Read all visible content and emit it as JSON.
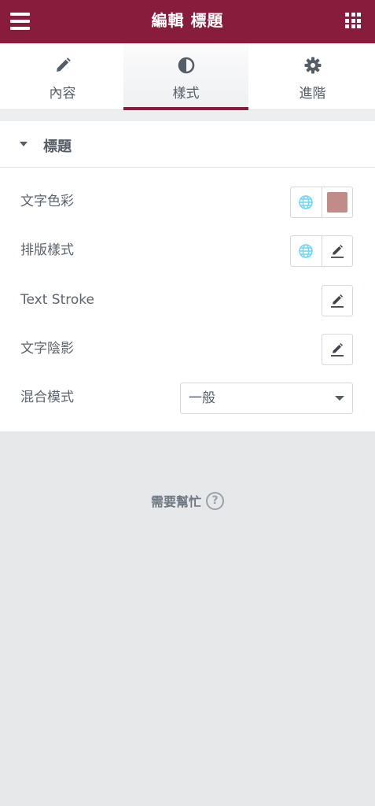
{
  "header": {
    "title": "編輯 標題",
    "menu_icon": "hamburger-icon",
    "apps_icon": "grid-icon",
    "background_color": "#871c3c"
  },
  "tabs": [
    {
      "label": "內容",
      "icon": "pencil-icon",
      "active": false
    },
    {
      "label": "樣式",
      "icon": "half-circle-icon",
      "active": true
    },
    {
      "label": "進階",
      "icon": "gear-icon",
      "active": false
    }
  ],
  "section": {
    "title": "標題",
    "expanded": true
  },
  "controls": {
    "text_color": {
      "label": "文字色彩",
      "swatch_color": "#c18c88",
      "global_icon": "globe-icon"
    },
    "typography": {
      "label": "排版樣式",
      "global_icon": "globe-icon",
      "edit_icon": "pencil-icon"
    },
    "text_stroke": {
      "label": "Text Stroke",
      "edit_icon": "pencil-icon"
    },
    "text_shadow": {
      "label": "文字陰影",
      "edit_icon": "pencil-icon"
    },
    "blend_mode": {
      "label": "混合模式",
      "selected": "一般"
    }
  },
  "help": {
    "label": "需要幫忙",
    "icon": "question-circle-icon"
  },
  "colors": {
    "accent": "#871c3c",
    "globe": "#71d7f7",
    "text": "#555d66"
  }
}
